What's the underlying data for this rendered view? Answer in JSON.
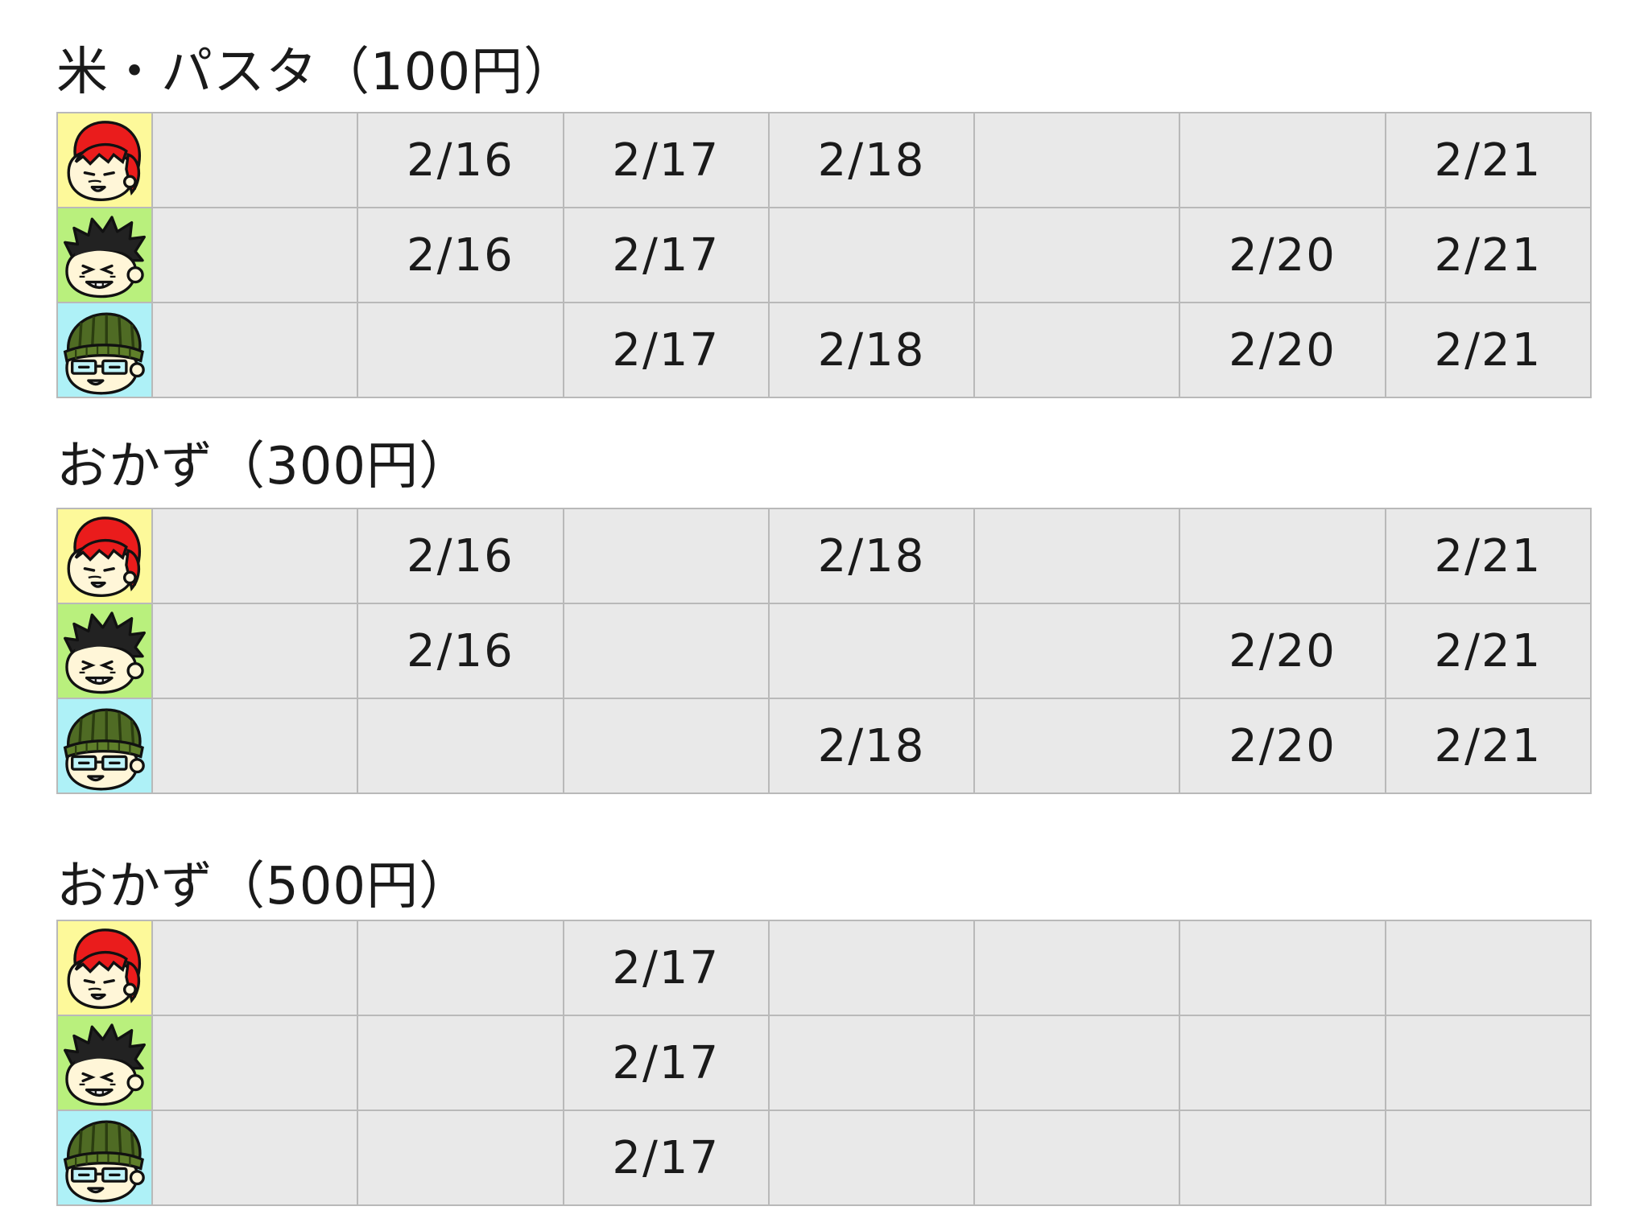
{
  "sections": [
    {
      "title": "米・パスタ（100円）",
      "rows": [
        {
          "avatar": "red-hair-person-icon",
          "bg": "#fdf99a",
          "cells": [
            "",
            "2/16",
            "2/17",
            "2/18",
            "",
            "",
            "2/21"
          ]
        },
        {
          "avatar": "black-hair-person-icon",
          "bg": "#b9f07d",
          "cells": [
            "",
            "2/16",
            "2/17",
            "",
            "",
            "2/20",
            "2/21"
          ]
        },
        {
          "avatar": "beanie-glasses-person-icon",
          "bg": "#aef1f7",
          "cells": [
            "",
            "",
            "2/17",
            "2/18",
            "",
            "2/20",
            "2/21"
          ]
        }
      ]
    },
    {
      "title": "おかず（300円）",
      "rows": [
        {
          "avatar": "red-hair-person-icon",
          "bg": "#fdf99a",
          "cells": [
            "",
            "2/16",
            "",
            "2/18",
            "",
            "",
            "2/21"
          ]
        },
        {
          "avatar": "black-hair-person-icon",
          "bg": "#b9f07d",
          "cells": [
            "",
            "2/16",
            "",
            "",
            "",
            "2/20",
            "2/21"
          ]
        },
        {
          "avatar": "beanie-glasses-person-icon",
          "bg": "#aef1f7",
          "cells": [
            "",
            "",
            "",
            "2/18",
            "",
            "2/20",
            "2/21"
          ]
        }
      ]
    },
    {
      "title": "おかず（500円）",
      "rows": [
        {
          "avatar": "red-hair-person-icon",
          "bg": "#fdf99a",
          "cells": [
            "",
            "",
            "2/17",
            "",
            "",
            "",
            ""
          ]
        },
        {
          "avatar": "black-hair-person-icon",
          "bg": "#b9f07d",
          "cells": [
            "",
            "",
            "2/17",
            "",
            "",
            "",
            ""
          ]
        },
        {
          "avatar": "beanie-glasses-person-icon",
          "bg": "#aef1f7",
          "cells": [
            "",
            "",
            "2/17",
            "",
            "",
            "",
            ""
          ]
        }
      ]
    }
  ]
}
